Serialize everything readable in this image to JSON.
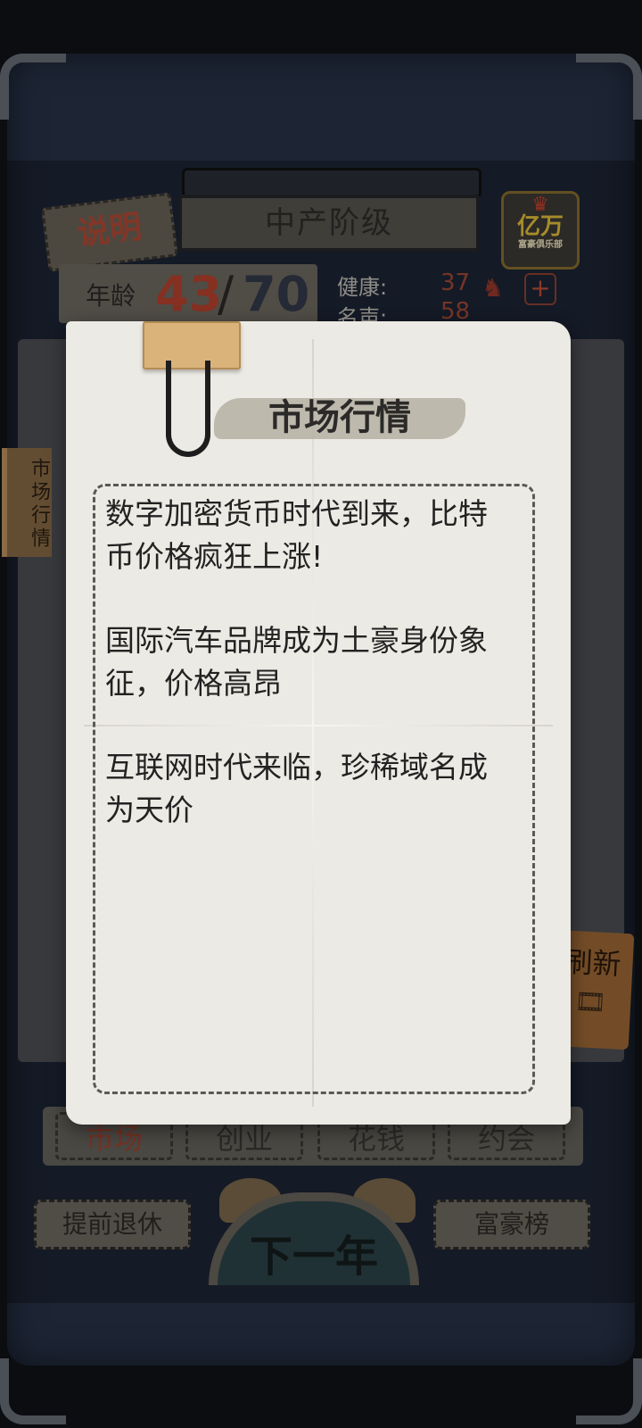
{
  "header": {
    "explain_label": "说明",
    "class_title": "中产阶级",
    "club_badge": {
      "main": "亿万",
      "sub": "富豪俱乐部",
      "icon": "crown-icon"
    }
  },
  "status": {
    "age_label": "年龄",
    "age_current": "43",
    "age_separator": "/",
    "age_max": "70",
    "health_label": "健康:",
    "health_value": "37",
    "fame_label": "名声:",
    "fame_value": "58"
  },
  "side_tab": {
    "label": "市场行情"
  },
  "refresh": {
    "label": "刷新"
  },
  "tabs": [
    {
      "label": "市场"
    },
    {
      "label": "创业"
    },
    {
      "label": "花钱"
    },
    {
      "label": "约会"
    }
  ],
  "bottom": {
    "retire_label": "提前退休",
    "next_year_label": "下一年",
    "rank_label": "富豪榜"
  },
  "modal": {
    "title": "市场行情",
    "news": [
      "数字加密货币时代到来，比特币价格疯狂上涨!",
      "国际汽车品牌成为土豪身份象征，价格高昂",
      "互联网时代来临，珍稀域名成为天价"
    ]
  },
  "colors": {
    "board": "#1d2535",
    "paper": "#eceae4",
    "accent_red": "#b9432f",
    "binder_tab": "#d9b37a"
  }
}
